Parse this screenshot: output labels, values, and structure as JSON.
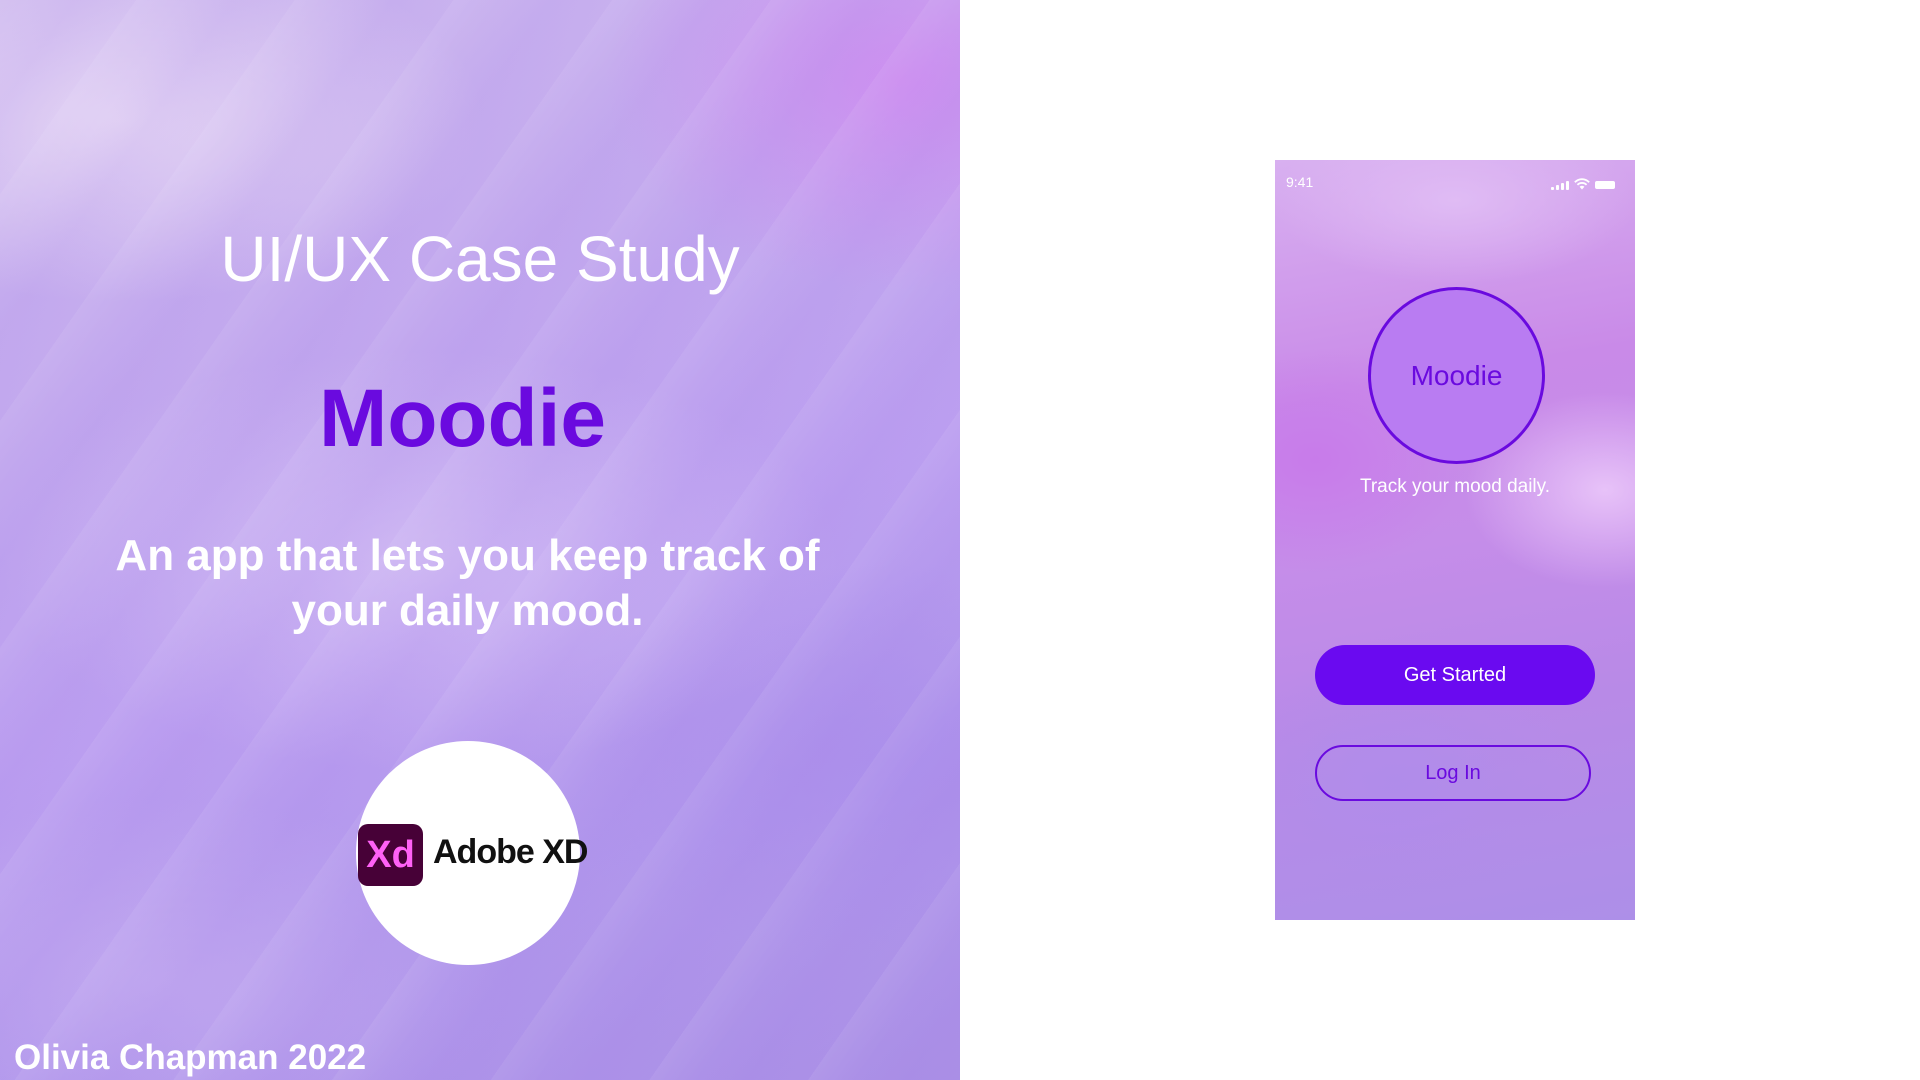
{
  "cover": {
    "title": "UI/UX Case Study",
    "app_name": "Moodie",
    "tagline": "An app that lets you keep track of your daily mood.",
    "tool_badge": {
      "logo_mark": "Xd",
      "logo_text": "Adobe XD"
    },
    "author": "Olivia Chapman 2022"
  },
  "phone": {
    "status_bar": {
      "time": "9:41",
      "icons": [
        "signal-icon",
        "wifi-icon",
        "battery-icon"
      ]
    },
    "logo_text": "Moodie",
    "tagline": "Track your mood daily.",
    "primary_button": "Get Started",
    "secondary_button": "Log In"
  },
  "colors": {
    "accent_purple": "#6a0adf",
    "button_purple": "#6a0af0",
    "logo_circle_fill": "#b97cf2",
    "xd_logo_bg": "#470137",
    "xd_logo_fg": "#ff61f6"
  }
}
